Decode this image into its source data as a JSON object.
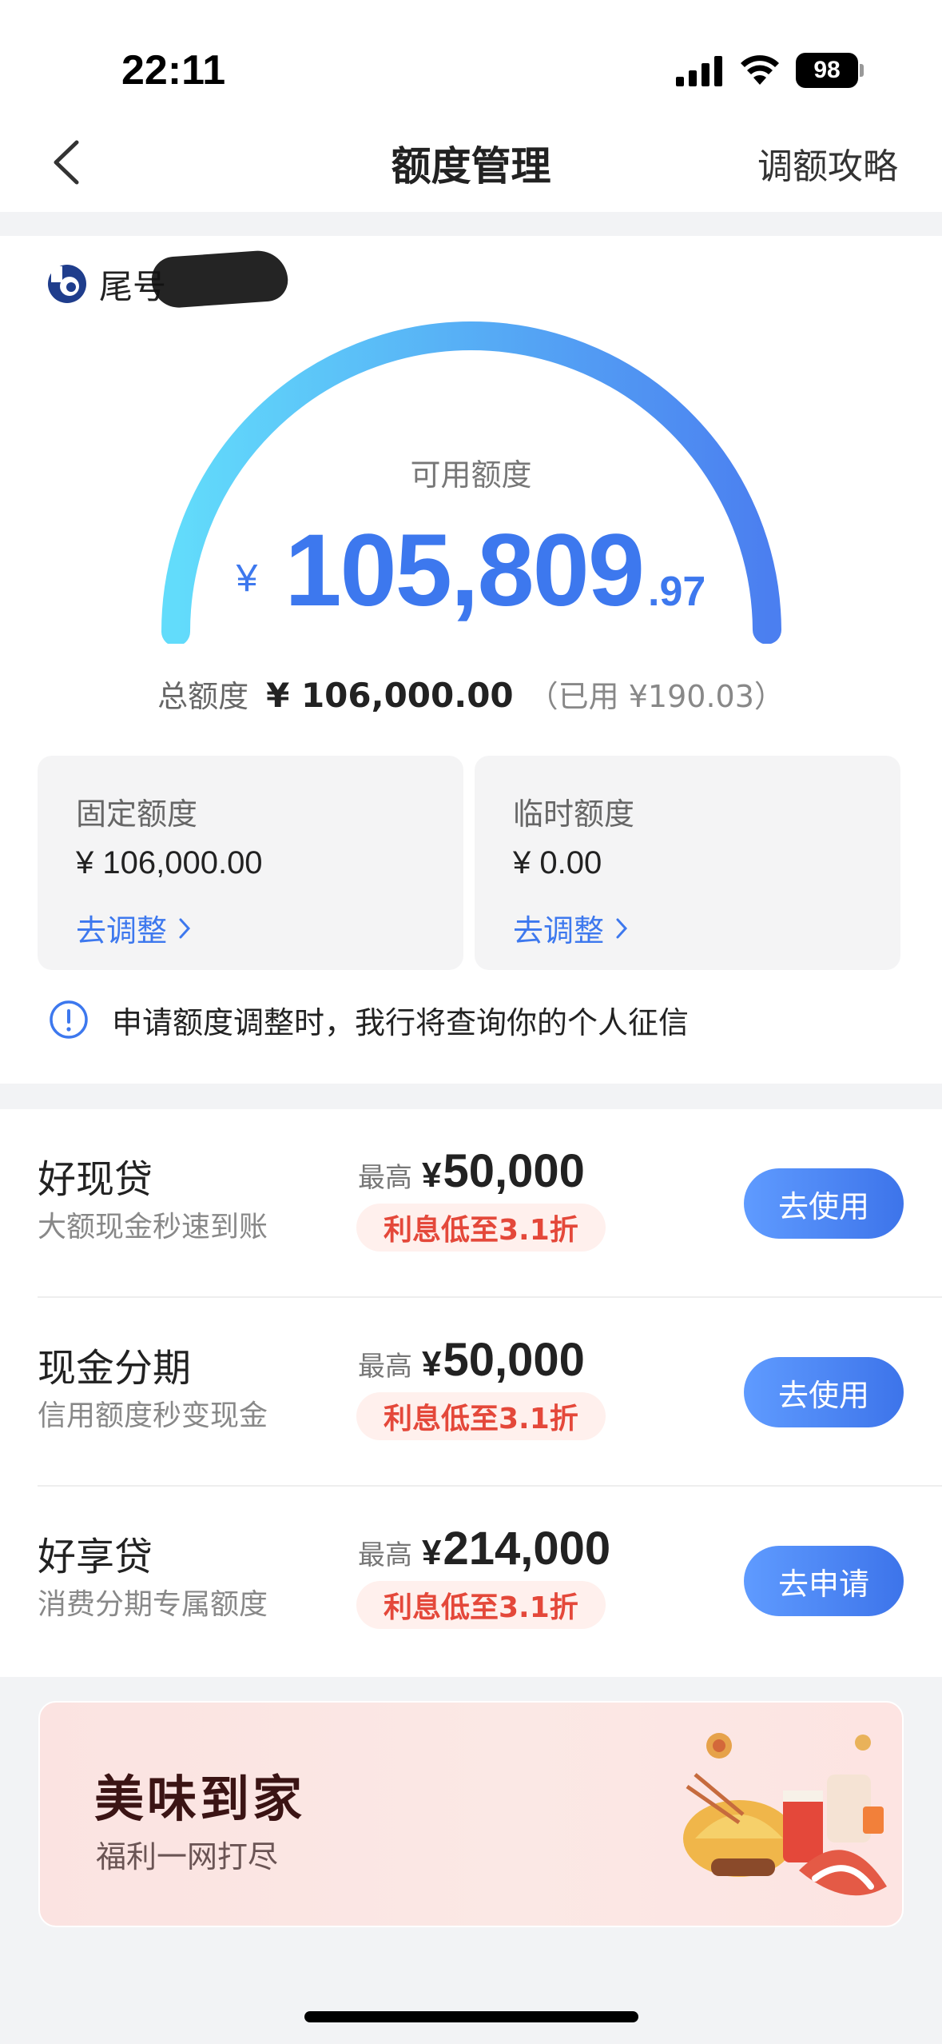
{
  "status_bar": {
    "time": "22:11",
    "battery": "98"
  },
  "nav": {
    "title": "额度管理",
    "right_link": "调额攻略"
  },
  "card": {
    "tag_prefix": "尾号",
    "gauge_fraction": 0.998,
    "available_label": "可用额度",
    "available_currency": "¥",
    "available_integer": "105,809",
    "available_decimal": ".97",
    "total_label": "总额度",
    "total_value": "¥ 106,000.00",
    "used_text": "（已用 ¥190.03）"
  },
  "fixed": {
    "title": "固定额度",
    "value": "¥ 106,000.00",
    "link": "去调整"
  },
  "temporary": {
    "title": "临时额度",
    "value": "¥ 0.00",
    "link": "去调整"
  },
  "notice": {
    "text": "申请额度调整时，我行将查询你的个人征信"
  },
  "products": [
    {
      "name": "好现贷",
      "desc": "大额现金秒速到账",
      "max_label": "最高",
      "currency": "¥",
      "max_value": "50,000",
      "badge": "利息低至3.1折",
      "button": "去使用"
    },
    {
      "name": "现金分期",
      "desc": "信用额度秒变现金",
      "max_label": "最高",
      "currency": "¥",
      "max_value": "50,000",
      "badge": "利息低至3.1折",
      "button": "去使用"
    },
    {
      "name": "好享贷",
      "desc": "消费分期专属额度",
      "max_label": "最高",
      "currency": "¥",
      "max_value": "214,000",
      "badge": "利息低至3.1折",
      "button": "去申请"
    }
  ],
  "banner": {
    "title": "美味到家",
    "subtitle": "福利一网打尽"
  },
  "colors": {
    "accent": "#3d78ee",
    "badge_text": "#e4483a",
    "gauge_start": "#62dcfb",
    "gauge_end": "#4b7ff0"
  }
}
